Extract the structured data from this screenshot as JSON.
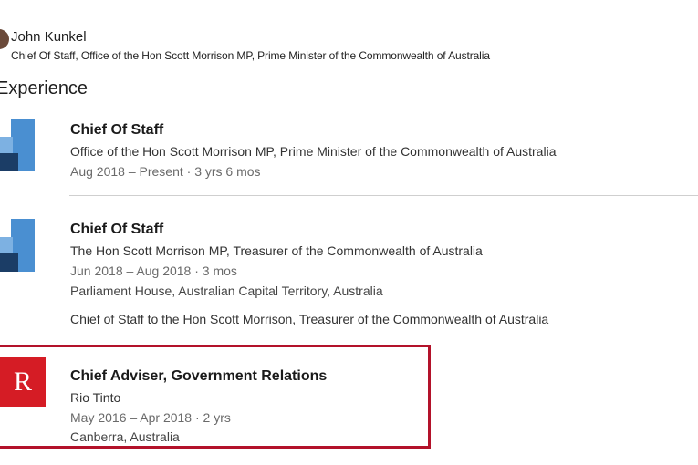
{
  "profile": {
    "name": "John Kunkel",
    "headline": "Chief Of Staff, Office of the Hon Scott Morrison MP, Prime Minister of the Commonwealth of Australia"
  },
  "experience": {
    "section_title": "Experience",
    "jobs": [
      {
        "title": "Chief Of Staff",
        "organization": "Office of the Hon Scott Morrison MP, Prime Minister of the Commonwealth of Australia",
        "dates": "Aug 2018 – Present · 3 yrs 6 mos",
        "logo_icon": "company-logo-icon"
      },
      {
        "title": "Chief Of Staff",
        "organization": "The Hon Scott Morrison MP, Treasurer of the Commonwealth of Australia",
        "dates": "Jun 2018 – Aug 2018 · 3 mos",
        "location": "Parliament House, Australian Capital Territory, Australia",
        "description": "Chief of Staff to the Hon Scott Morrison, Treasurer of the Commonwealth of Australia",
        "logo_icon": "company-logo-icon"
      },
      {
        "title": "Chief Adviser, Government Relations",
        "organization": "Rio Tinto",
        "dates": "May 2016 – Apr 2018 · 2 yrs",
        "location": "Canberra, Australia",
        "logo_letter": "R",
        "logo_color": "#d51c25",
        "highlight_color": "#b3122a"
      }
    ]
  }
}
